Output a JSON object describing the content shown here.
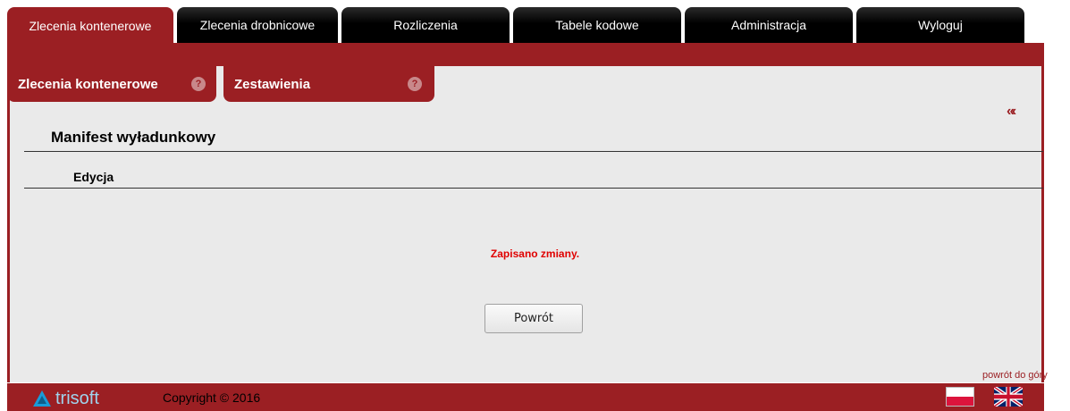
{
  "top_tabs": [
    {
      "label": "Zlecenia kontenerowe",
      "active": true
    },
    {
      "label": "Zlecenia drobnicowe",
      "active": false
    },
    {
      "label": "Rozliczenia",
      "active": false
    },
    {
      "label": "Tabele kodowe",
      "active": false
    },
    {
      "label": "Administracja",
      "active": false
    },
    {
      "label": "Wyloguj",
      "active": false
    }
  ],
  "sub_tabs": [
    {
      "label": "Zlecenia kontenerowe"
    },
    {
      "label": "Zestawienia"
    }
  ],
  "back_arrows": "«‹",
  "page": {
    "title": "Manifest wyładunkowy",
    "section": "Edycja",
    "message": "Zapisano zmiany.",
    "back_button_label": "Powrót"
  },
  "footer": {
    "to_top": "powrót do góry",
    "logo_text": "trisoft",
    "copyright": "Copyright © 2016"
  },
  "colors": {
    "brand": "#9b1f23",
    "message": "#e00000",
    "panel": "#eaeaea"
  }
}
